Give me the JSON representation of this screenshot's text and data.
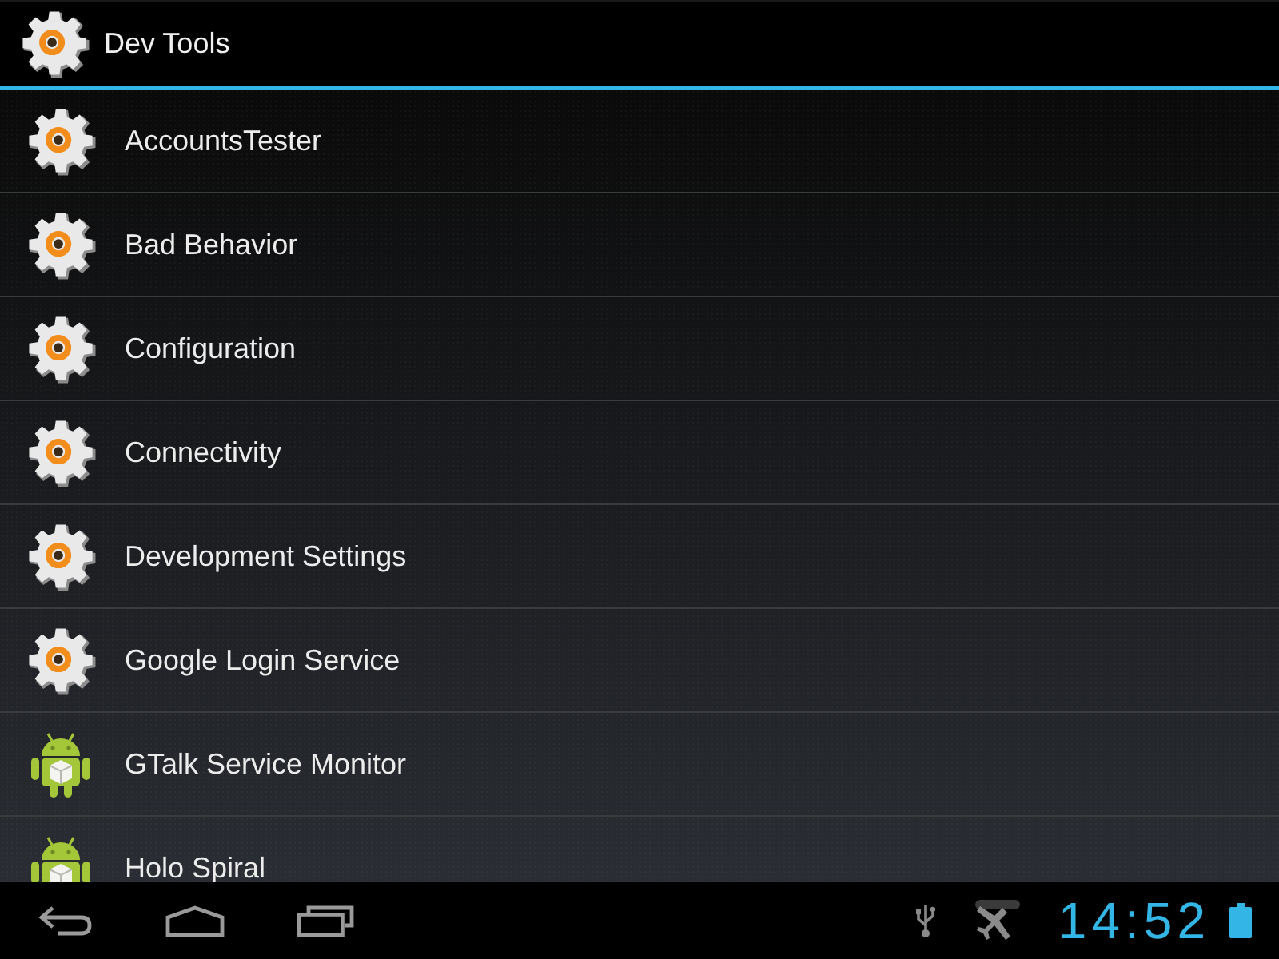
{
  "action_bar": {
    "title": "Dev Tools"
  },
  "apps": [
    {
      "label": "AccountsTester",
      "kind": "gear"
    },
    {
      "label": "Bad Behavior",
      "kind": "gear"
    },
    {
      "label": "Configuration",
      "kind": "gear"
    },
    {
      "label": "Connectivity",
      "kind": "gear"
    },
    {
      "label": "Development Settings",
      "kind": "gear"
    },
    {
      "label": "Google Login Service",
      "kind": "gear"
    },
    {
      "label": "GTalk Service Monitor",
      "kind": "android"
    },
    {
      "label": "Holo Spiral",
      "kind": "android"
    }
  ],
  "system_bar": {
    "time": "14:52"
  }
}
